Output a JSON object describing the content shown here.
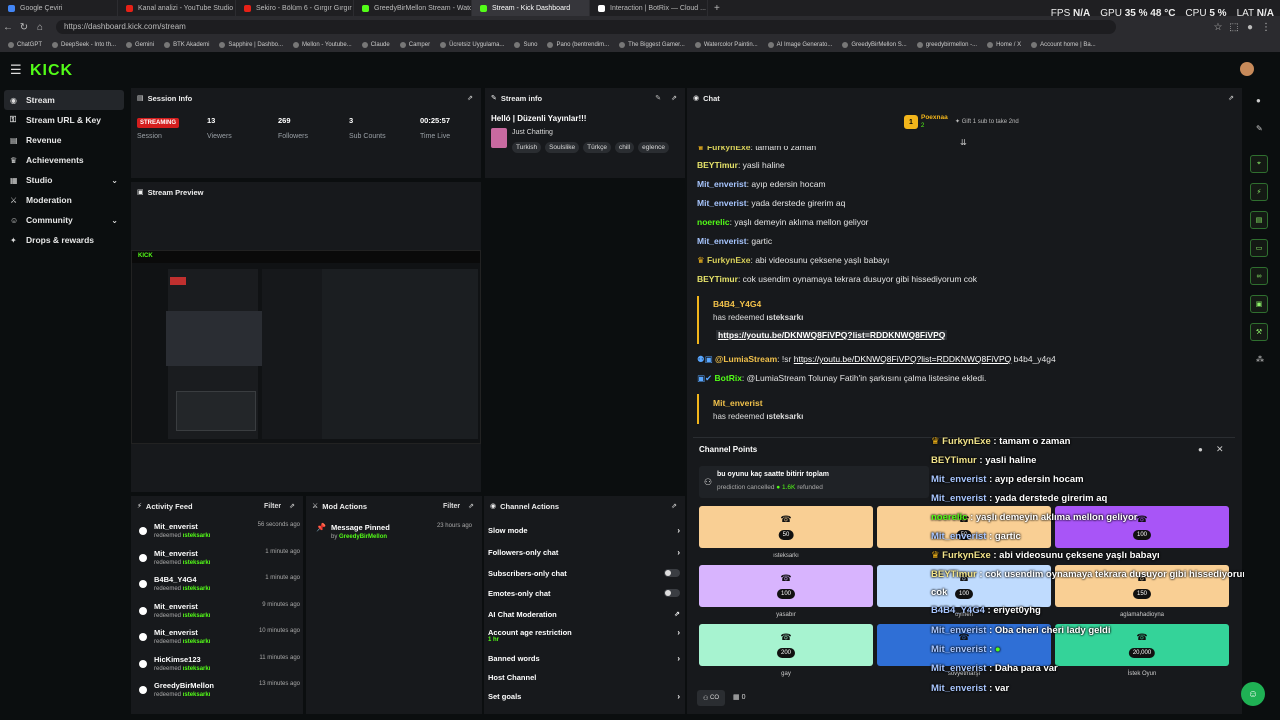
{
  "browser": {
    "tabs": [
      {
        "label": "Google Çeviri",
        "color": "#4285f4",
        "active": false
      },
      {
        "label": "Kanal analizi - YouTube Studio",
        "color": "#e62117",
        "active": false
      },
      {
        "label": "Sekiro - Bölüm 6 - Gırgır Gırgır - Y",
        "color": "#e62117",
        "active": false
      },
      {
        "label": "GreedyBirMellon Stream - Watch ...",
        "color": "#53fc18",
        "active": false
      },
      {
        "label": "Stream - Kick Dashboard",
        "color": "#53fc18",
        "active": true
      },
      {
        "label": "Interaction | BotRix — Cloud ...",
        "color": "#ffffff",
        "active": false
      }
    ],
    "new_tab": "+",
    "url": "https://dashboard.kick.com/stream",
    "perf": {
      "fps_label": "FPS",
      "fps": "N/A",
      "gpu_label": "GPU",
      "gpu": "35 %  48 °C",
      "cpu_label": "CPU",
      "cpu": "5 %",
      "lat_label": "LAT",
      "lat": "N/A"
    },
    "bookmarks": [
      "ChatGPT",
      "DeepSeek - Into th...",
      "Gemini",
      "BTK Akademi",
      "Sapphire | Dashbo...",
      "Mellon - Youtube...",
      "Claude",
      "Camper",
      "Ücretsiz Uygulama...",
      "Suno",
      "Pano (bentrendim...",
      "The Biggest Gamer...",
      "Watercolor Paintin...",
      "AI Image Generato...",
      "GreedyBirMellon S...",
      "greedybirmellon -...",
      "Home / X",
      "Account home | Ba..."
    ]
  },
  "brand": {
    "logo": "KICK",
    "accent": "#53fc18"
  },
  "sidebar": {
    "items": [
      {
        "label": "Stream",
        "icon": "broadcast-icon",
        "glyph": "◉",
        "active": true,
        "chevron": false
      },
      {
        "label": "Stream URL & Key",
        "icon": "key-icon",
        "glyph": "⚿",
        "active": false,
        "chevron": false
      },
      {
        "label": "Revenue",
        "icon": "money-icon",
        "glyph": "▤",
        "active": false,
        "chevron": false
      },
      {
        "label": "Achievements",
        "icon": "trophy-icon",
        "glyph": "♛",
        "active": false,
        "chevron": false
      },
      {
        "label": "Studio",
        "icon": "studio-icon",
        "glyph": "▦",
        "active": false,
        "chevron": true
      },
      {
        "label": "Moderation",
        "icon": "sword-icon",
        "glyph": "⚔",
        "active": false,
        "chevron": false
      },
      {
        "label": "Community",
        "icon": "people-icon",
        "glyph": "☺",
        "active": false,
        "chevron": true
      },
      {
        "label": "Drops & rewards",
        "icon": "gift-icon",
        "glyph": "✦",
        "active": false,
        "chevron": false
      }
    ]
  },
  "session": {
    "title": "Session Info",
    "badge": "STREAMING",
    "session_label": "Session",
    "stats": [
      {
        "value": "13",
        "label": "Viewers"
      },
      {
        "value": "269",
        "label": "Followers"
      },
      {
        "value": "3",
        "label": "Sub Counts"
      },
      {
        "value": "00:25:57",
        "label": "Time Live"
      }
    ]
  },
  "stream_info": {
    "title": "Stream info",
    "stream_title": "Helló | Düzenli Yayınlar!!!",
    "category": "Just Chatting",
    "tags": [
      "Turkish",
      "Soulslike",
      "Türkçe",
      "chill",
      "eglence"
    ]
  },
  "preview": {
    "title": "Stream Preview"
  },
  "chat": {
    "title": "Chat",
    "top_gifter": "Poexnaa",
    "top_gifter_count": "2",
    "gift_hint": "Gift 1 sub to take 2nd",
    "lines": [
      {
        "nick": "FurkynExe",
        "color": "#d8d05a",
        "text": "tamam o zaman"
      },
      {
        "nick": "BEYTimur",
        "color": "#e6e36a",
        "text": "yasli haline"
      },
      {
        "nick": "Mit_enverist",
        "color": "#a8c6ff",
        "text": "ayıp edersin hocam"
      },
      {
        "nick": "Mit_enverist",
        "color": "#a8c6ff",
        "text": "yada derstede girerim aq"
      },
      {
        "nick": "noerelic",
        "color": "#53fc18",
        "text": "yaşlı demeyin aklıma mellon geliyor"
      },
      {
        "nick": "Mit_enverist",
        "color": "#a8c6ff",
        "text": "gartic"
      },
      {
        "nick": "FurkynExe",
        "color": "#d8d05a",
        "text": "abi videosunu çeksene yaşlı babayı"
      },
      {
        "nick": "BEYTimur",
        "color": "#e6e36a",
        "text": "cok usendim oynamaya tekrara dusuyor gibi hissediyorum cok"
      }
    ],
    "redeem1": {
      "nick": "B4B4_Y4G4",
      "text": "has redeemed",
      "reward": "ısteksarkı",
      "link": "https://youtu.be/DKNWQ8FiVPQ?list=RDDKNWQ8FiVPQ"
    },
    "lumia": {
      "nick": "@LumiaStream",
      "prefix": "!sr",
      "link": "https://youtu.be/DKNWQ8FiVPQ?list=RDDKNWQ8FiVPQ",
      "suffix": "b4b4_y4g4"
    },
    "botrix": {
      "nick": "BotRix",
      "text": "@LumiaStream Tolunay Fatih'in şarkısını çalma listesine ekledi."
    },
    "redeem2": {
      "nick": "Mit_enverist",
      "text": "has redeemed",
      "reward": "ısteksarkı"
    }
  },
  "channel_points": {
    "title": "Channel Points",
    "prediction_title": "bu oyunu kaç saatte bitirir toplam",
    "prediction_status": "prediction cancelled",
    "prediction_amount": "1.6K",
    "prediction_refund": "refunded",
    "cards": [
      {
        "cost": "50",
        "label": "ısteksarkı",
        "color": "#f9cf94"
      },
      {
        "cost": "50",
        "label": "",
        "color": "#f9cf94"
      },
      {
        "cost": "100",
        "label": "",
        "color": "#a855f7"
      },
      {
        "cost": "100",
        "label": "yasabır",
        "color": "#d8b4fe"
      },
      {
        "cost": "100",
        "label": "oymen",
        "color": "#bfdbfe"
      },
      {
        "cost": "150",
        "label": "aglamahadioyna",
        "color": "#f9cf94"
      },
      {
        "cost": "200",
        "label": "gay",
        "color": "#a7f3d0"
      },
      {
        "cost": "",
        "label": "sovyetmarşı",
        "color": "#2f6fd6"
      },
      {
        "cost": "20,000",
        "label": "İstek Oyun",
        "color": "#34d399"
      }
    ],
    "footer_cc": "CO",
    "footer_count": "0"
  },
  "overlay_chat": [
    {
      "nick": "FurkynExe",
      "color": "#f1e38a",
      "text": " : tamam o zaman",
      "crown": true
    },
    {
      "nick": "BEYTimur",
      "color": "#f1e38a",
      "text": " : yasli haline",
      "crown": false
    },
    {
      "nick": "Mit_enverist",
      "color": "#a8c6ff",
      "text": " : ayıp edersin hocam",
      "crown": false
    },
    {
      "nick": "Mit_enverist",
      "color": "#a8c6ff",
      "text": " : yada derstede girerim aq",
      "crown": false
    },
    {
      "nick": "noerelic",
      "color": "#53fc18",
      "text": " : yaşlı demeyin aklıma mellon geliyor",
      "crown": false
    },
    {
      "nick": "Mit_enverist",
      "color": "#a8c6ff",
      "text": " : gartic",
      "crown": false
    },
    {
      "nick": "FurkynExe",
      "color": "#f1e38a",
      "text": " : abi videosunu çeksene yaşlı babayı",
      "crown": true
    },
    {
      "nick": "BEYTimur",
      "color": "#f1e38a",
      "text": " : cok usendim oynamaya tekrara dusuyor gibi hissediyorum",
      "crown": false
    },
    {
      "nick": "cok",
      "color": "#ffffff",
      "text": "",
      "crown": false
    },
    {
      "nick": "B4B4_Y4G4",
      "color": "#a8c6ff",
      "text": " : eriyet0yhg",
      "crown": false
    },
    {
      "nick": "Mit_enverist",
      "color": "#a8c6ff",
      "text": " : Oba cheri cheri lady geldi",
      "crown": false
    },
    {
      "nick": "Mit_enverist",
      "color": "#a8c6ff",
      "text": " : ",
      "crown": false
    },
    {
      "nick": "Mit_enverist",
      "color": "#a8c6ff",
      "text": " : Daha para var",
      "crown": false
    },
    {
      "nick": "Mit_enverist",
      "color": "#a8c6ff",
      "text": " : var",
      "crown": false
    }
  ],
  "activity": {
    "title": "Activity Feed",
    "filter": "Filter",
    "rows": [
      {
        "name": "Mit_enverist",
        "sub": "redeemed",
        "reward": "ısteksarkı",
        "time": "56 seconds ago"
      },
      {
        "name": "Mit_enverist",
        "sub": "redeemed",
        "reward": "ısteksarkı",
        "time": "1 minute ago"
      },
      {
        "name": "B4B4_Y4G4",
        "sub": "redeemed",
        "reward": "ısteksarkı",
        "time": "1 minute ago"
      },
      {
        "name": "Mit_enverist",
        "sub": "redeemed",
        "reward": "ısteksarkı",
        "time": "9 minutes ago"
      },
      {
        "name": "Mit_enverist",
        "sub": "redeemed",
        "reward": "ısteksarkı",
        "time": "10 minutes ago"
      },
      {
        "name": "HicKimse123",
        "sub": "redeemed",
        "reward": "ısteksarkı",
        "time": "11 minutes ago"
      },
      {
        "name": "GreedyBirMellon",
        "sub": "redeemed",
        "reward": "ısteksarkı",
        "time": "13 minutes ago"
      }
    ]
  },
  "mod_actions": {
    "title": "Mod Actions",
    "filter": "Filter",
    "item_title": "Message Pinned",
    "item_by": "by",
    "item_user": "GreedyBirMellon",
    "item_time": "23 hours ago"
  },
  "channel_actions": {
    "title": "Channel Actions",
    "rows": [
      {
        "label": "Slow mode",
        "kind": "chevron",
        "sub": ""
      },
      {
        "label": "Followers-only chat",
        "kind": "chevron",
        "sub": ""
      },
      {
        "label": "Subscribers-only chat",
        "kind": "toggle",
        "sub": ""
      },
      {
        "label": "Emotes-only chat",
        "kind": "toggle",
        "sub": ""
      },
      {
        "label": "AI Chat Moderation",
        "kind": "external",
        "sub": ""
      },
      {
        "label": "Account age restriction",
        "kind": "chevron",
        "sub": "1 hr"
      },
      {
        "label": "Banned words",
        "kind": "chevron",
        "sub": ""
      },
      {
        "label": "Host Channel",
        "kind": "none",
        "sub": ""
      },
      {
        "label": "Set goals",
        "kind": "chevron",
        "sub": ""
      }
    ]
  }
}
